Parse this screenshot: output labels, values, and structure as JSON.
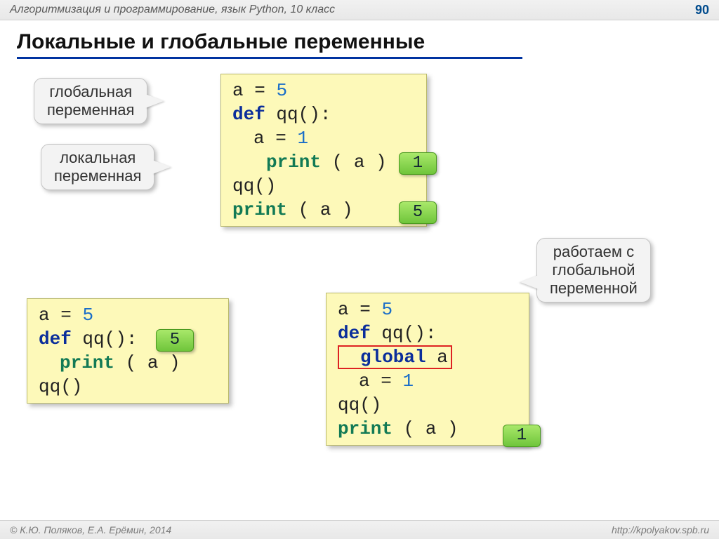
{
  "header": {
    "course": "Алгоритмизация и программирование, язык Python, 10 класс",
    "slide": "90"
  },
  "title": "Локальные и глобальные переменные",
  "callouts": {
    "global_var": "глобальная\nпеременная",
    "local_var": "локальная\nпеременная",
    "work_global": "работаем с\nглобальной\nпеременной"
  },
  "code1": {
    "l1a": "a",
    "l1b": "=",
    "l1c": "5",
    "l2a": "def",
    "l2b": " qq():",
    "l3a": "a",
    "l3b": "=",
    "l3c": "1",
    "l4a": "print",
    "l4b": " ( a )",
    "l5": "qq()",
    "l6a": "print",
    "l6b": " ( a )"
  },
  "badges1": {
    "out1": "1",
    "out2": "5"
  },
  "code2": {
    "l1a": "a",
    "l1b": "=",
    "l1c": "5",
    "l2a": "def",
    "l2b": " qq():",
    "l3a": "print",
    "l3b": " ( a )",
    "l4": "qq()"
  },
  "badges2": {
    "out1": "5"
  },
  "code3": {
    "l1a": "a",
    "l1b": "=",
    "l1c": "5",
    "l2a": "def",
    "l2b": " qq():",
    "l3a": "global",
    "l3b": " a",
    "l4a": "a",
    "l4b": "=",
    "l4c": "1",
    "l5": "qq()",
    "l6a": "print",
    "l6b": " ( a )"
  },
  "badges3": {
    "out1": "1"
  },
  "footer": {
    "copyright": "© К.Ю. Поляков, Е.А. Ерёмин, 2014",
    "url": "http://kpolyakov.spb.ru"
  }
}
